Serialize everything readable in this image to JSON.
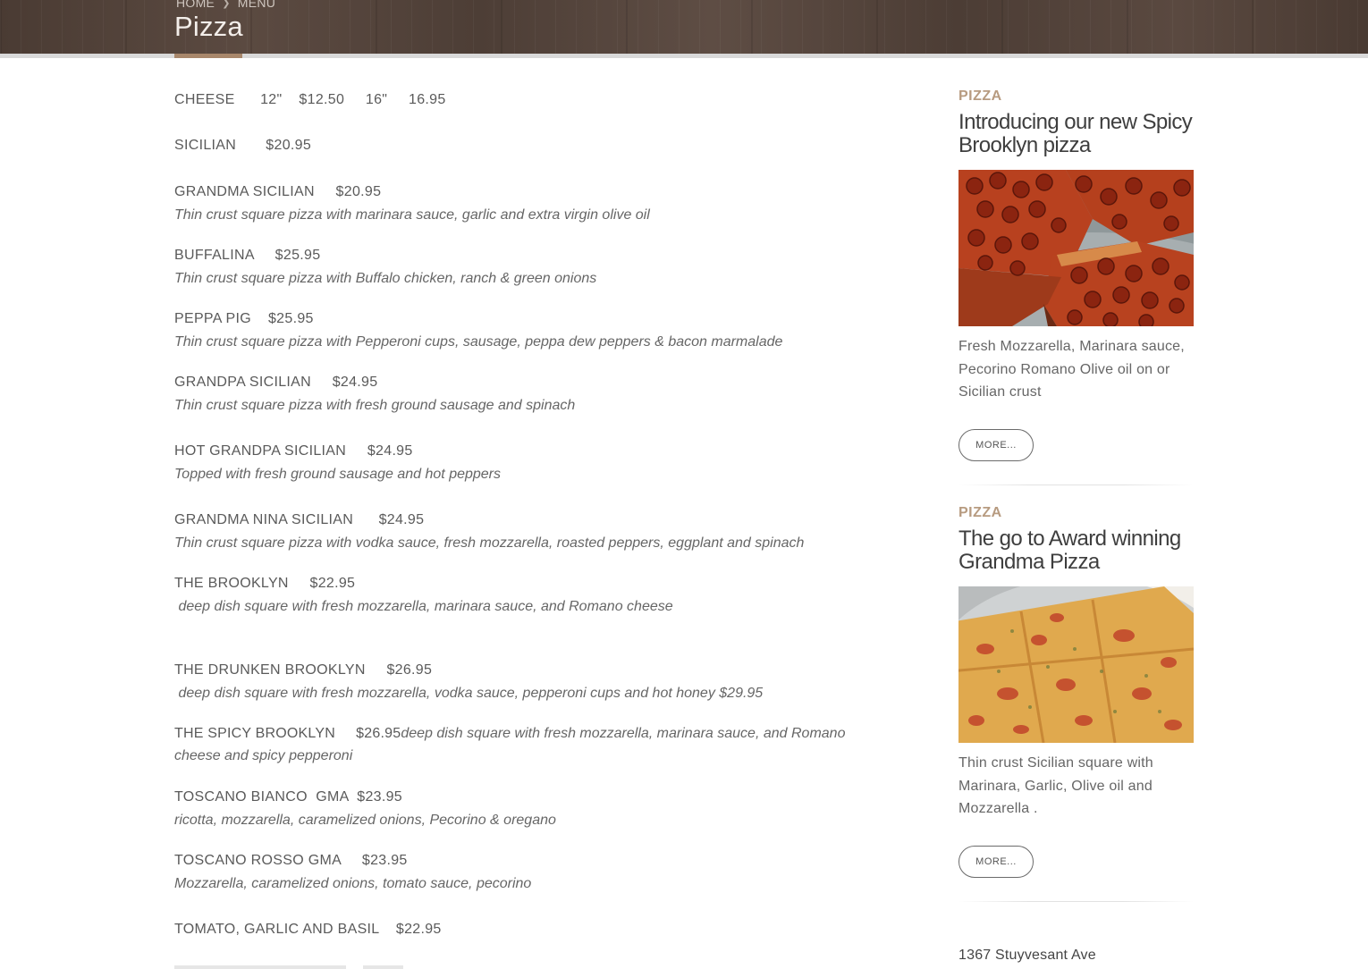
{
  "header": {
    "breadcrumb": [
      "HOME",
      "MENU"
    ],
    "title": "Pizza"
  },
  "menu": {
    "items": [
      {
        "name": "CHEESE      12\"    $12.50     16\"     16.95",
        "desc": ""
      },
      {
        "name": "SICILIAN       $20.95",
        "desc": ""
      },
      {
        "name": "GRANDMA SICILIAN     $20.95",
        "desc": "Thin crust square pizza with marinara sauce, garlic and extra virgin olive oil"
      },
      {
        "name": "BUFFALINA     $25.95",
        "desc": "Thin crust square pizza with Buffalo chicken, ranch & green onions"
      },
      {
        "name": "PEPPA PIG    $25.95",
        "desc": "Thin crust square pizza with Pepperoni cups, sausage, peppa dew peppers & bacon marmalade"
      },
      {
        "name": "GRANDPA SICILIAN     $24.95",
        "desc": "Thin crust square pizza with fresh ground sausage and spinach"
      },
      {
        "name": "HOT GRANDPA SICILIAN     $24.95",
        "desc": "Topped with fresh ground sausage and hot peppers"
      },
      {
        "name": "GRANDMA NINA SICILIAN      $24.95",
        "desc": "Thin crust square pizza with vodka sauce, fresh mozzarella, roasted peppers, eggplant and spinach"
      },
      {
        "name": "THE BROOKLYN     $22.95",
        "desc": " deep dish square with fresh mozzarella, marinara sauce, and Romano cheese"
      },
      {
        "name": "THE DRUNKEN BROOKLYN     $26.95",
        "desc": " deep dish square with fresh mozzarella, vodka sauce, pepperoni cups and hot honey $29.95"
      },
      {
        "name": "TOSCANO BIANCO  GMA  $23.95",
        "desc": "ricotta, mozzarella, caramelized onions, Pecorino & oregano"
      },
      {
        "name": "TOSCANO ROSSO GMA     $23.95",
        "desc": "Mozzarella, caramelized onions, tomato sauce, pecorino"
      },
      {
        "name": "TOMATO, GARLIC AND BASIL    $22.95",
        "desc": ""
      }
    ],
    "spicy": {
      "name": "THE SPICY BROOKLYN     $26.95",
      "desc": "deep dish square with fresh mozzarella, marinara sauce, and Romano cheese and spicy pepperoni"
    }
  },
  "sidebar": {
    "cards": [
      {
        "category": "PIZZA",
        "title": "Introducing our new Spicy Brooklyn pizza",
        "image_alt": "pepperoni square pizza",
        "text": "Fresh Mozzarella, Marinara sauce, Pecorino Romano Olive oil on or Sicilian crust",
        "button": "MORE..."
      },
      {
        "category": "PIZZA",
        "title": "The go to Award winning Grandma Pizza",
        "image_alt": "grandma square pizza",
        "text": "Thin crust Sicilian square with Marinara, Garlic, Olive oil and Mozzarella .",
        "button": "MORE..."
      }
    ],
    "address": "1367 Stuyvesant Ave"
  },
  "colors": {
    "accent": "#a8876b",
    "category": "#b79b80",
    "header_wood": "#4f4038"
  }
}
